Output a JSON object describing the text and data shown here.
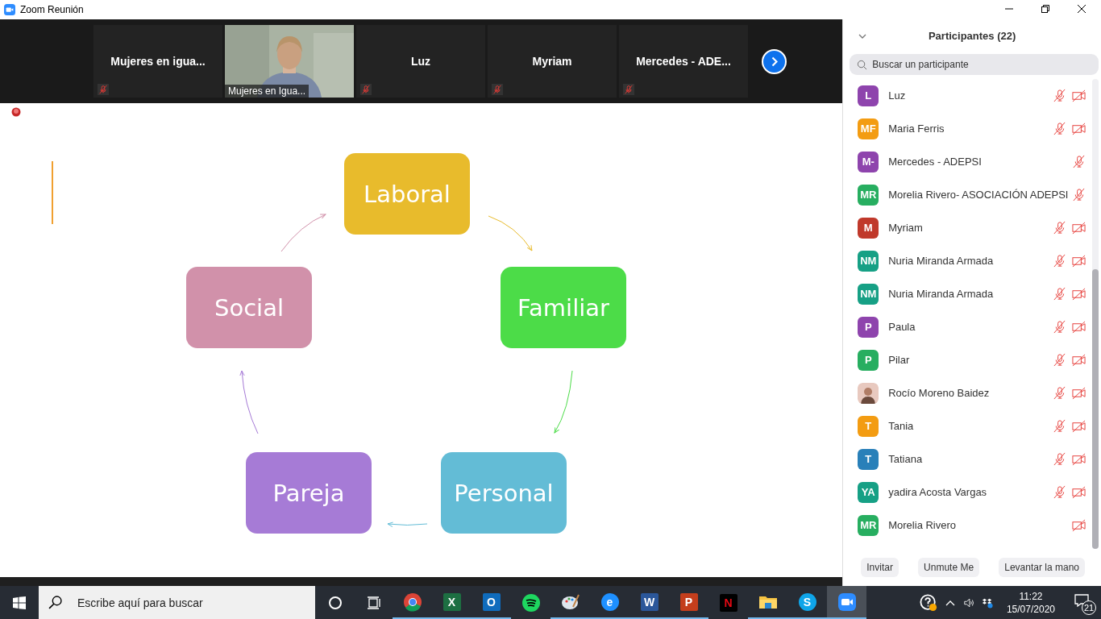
{
  "window": {
    "title": "Zoom Reunión"
  },
  "video_strip": {
    "tiles": [
      {
        "kind": "name",
        "name": "Mujeres en igua...",
        "mic_muted": true
      },
      {
        "kind": "video",
        "name": "Mujeres en Igua...",
        "mic_muted": false
      },
      {
        "kind": "name",
        "name": "Luz",
        "mic_muted": true
      },
      {
        "kind": "name",
        "name": "Myriam",
        "mic_muted": true
      },
      {
        "kind": "name",
        "name": "Mercedes - ADE...",
        "mic_muted": true
      }
    ]
  },
  "shared_screen": {
    "nodes": [
      {
        "label": "Laboral",
        "color": "#e8bb2c"
      },
      {
        "label": "Familiar",
        "color": "#4cdc48"
      },
      {
        "label": "Personal",
        "color": "#63bcd6"
      },
      {
        "label": "Pareja",
        "color": "#a67bd6"
      },
      {
        "label": "Social",
        "color": "#d191aa"
      }
    ]
  },
  "participants": {
    "title": "Participantes (22)",
    "search": {
      "placeholder": "Buscar un participante"
    },
    "items": [
      {
        "kind": "initials",
        "initials": "L",
        "name": "Luz",
        "color": "#8e44ad",
        "mic_muted": true,
        "video_off": true
      },
      {
        "kind": "initials",
        "initials": "MF",
        "name": "Maria Ferris",
        "color": "#f39c12",
        "mic_muted": true,
        "video_off": true
      },
      {
        "kind": "initials",
        "initials": "M-",
        "name": "Mercedes - ADEPSI",
        "color": "#8e44ad",
        "mic_muted": true,
        "video_off": false
      },
      {
        "kind": "initials",
        "initials": "MR",
        "name": "Morelia Rivero- ASOCIACIÓN ADEPSI",
        "color": "#27ae60",
        "mic_muted": true,
        "video_off": false
      },
      {
        "kind": "initials",
        "initials": "M",
        "name": "Myriam",
        "color": "#c0392b",
        "mic_muted": true,
        "video_off": true
      },
      {
        "kind": "initials",
        "initials": "NM",
        "name": "Nuria Miranda Armada",
        "color": "#16a085",
        "mic_muted": true,
        "video_off": true
      },
      {
        "kind": "initials",
        "initials": "NM",
        "name": "Nuria Miranda Armada",
        "color": "#16a085",
        "mic_muted": true,
        "video_off": true
      },
      {
        "kind": "initials",
        "initials": "P",
        "name": "Paula",
        "color": "#8e44ad",
        "mic_muted": true,
        "video_off": true
      },
      {
        "kind": "initials",
        "initials": "P",
        "name": "Pilar",
        "color": "#27ae60",
        "mic_muted": true,
        "video_off": true
      },
      {
        "name": "Rocío Moreno Baidez",
        "mic_muted": true,
        "video_off": true
      },
      {
        "kind": "initials",
        "initials": "T",
        "name": "Tania",
        "color": "#f39c12",
        "mic_muted": true,
        "video_off": true
      },
      {
        "kind": "initials",
        "initials": "T",
        "name": "Tatiana",
        "color": "#2980b9",
        "mic_muted": true,
        "video_off": true
      },
      {
        "kind": "initials",
        "initials": "YA",
        "name": "yadira Acosta Vargas",
        "color": "#16a085",
        "mic_muted": true,
        "video_off": true
      },
      {
        "kind": "initials",
        "initials": "MR",
        "name": "Morelia Rivero",
        "color": "#27ae60",
        "mic_muted": false,
        "video_off": true
      }
    ],
    "buttons": [
      "Invitar",
      "Unmute Me",
      "Levantar la mano"
    ]
  },
  "taskbar": {
    "search": {
      "placeholder": "Escribe aquí para buscar"
    },
    "apps": [
      {
        "kind": "browser",
        "running": true,
        "selected": false
      },
      {
        "kind": "spreadsheet",
        "glyph": "X",
        "running": true,
        "selected": false
      },
      {
        "kind": "mail",
        "glyph": "O",
        "running": true,
        "selected": false
      },
      {
        "kind": "music",
        "running": false,
        "selected": false
      },
      {
        "kind": "paint",
        "running": true,
        "selected": false
      },
      {
        "kind": "globe",
        "glyph": "e",
        "running": true,
        "selected": false
      },
      {
        "kind": "document",
        "glyph": "W",
        "running": true,
        "selected": false
      },
      {
        "kind": "slides",
        "glyph": "P",
        "running": true,
        "selected": false
      },
      {
        "kind": "movie",
        "glyph": "N",
        "running": false,
        "selected": false
      },
      {
        "kind": "folder",
        "running": true,
        "selected": false
      },
      {
        "kind": "chat",
        "glyph": "S",
        "running": true,
        "selected": false
      },
      {
        "kind": "camera",
        "running": true,
        "selected": true
      }
    ],
    "time": "11:22",
    "date": "15/07/2020",
    "notifications": "21"
  }
}
